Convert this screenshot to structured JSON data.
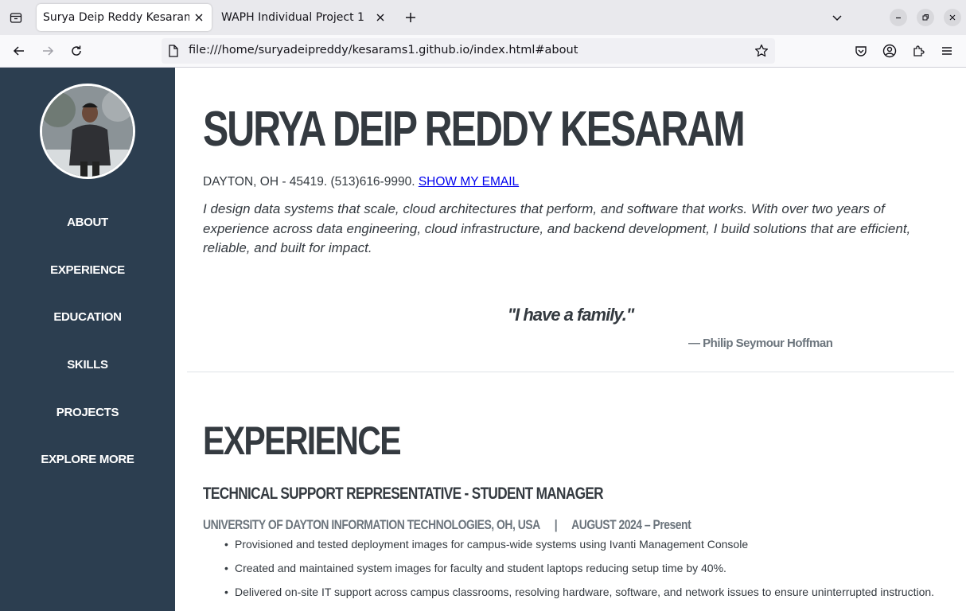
{
  "browser": {
    "tabs": [
      {
        "title": "Surya Deip Reddy Kesaram - I",
        "active": true
      },
      {
        "title": "WAPH Individual Project 1",
        "active": false
      }
    ],
    "url": "file:///home/suryadeipreddy/kesarams1.github.io/index.html#about"
  },
  "sidebar": {
    "items": [
      {
        "label": "ABOUT"
      },
      {
        "label": "EXPERIENCE"
      },
      {
        "label": "EDUCATION"
      },
      {
        "label": "SKILLS"
      },
      {
        "label": "PROJECTS"
      },
      {
        "label": "EXPLORE MORE"
      }
    ]
  },
  "about": {
    "name": "SURYA DEIP REDDY KESARAM",
    "contact": "DAYTON, OH - 45419. (513)616-9990.",
    "email_link": "SHOW MY EMAIL",
    "intro": "I design data systems that scale, cloud architectures that perform, and software that works. With over two years of experience across data engineering, cloud infrastructure, and backend development, I build solutions that are efficient, reliable, and built for impact.",
    "quote": "\"I have a family.\"",
    "quote_author": "— Philip Seymour Hoffman"
  },
  "experience": {
    "heading": "EXPERIENCE",
    "job_title": "TECHNICAL SUPPORT REPRESENTATIVE - STUDENT MANAGER",
    "company": "UNIVERSITY OF DAYTON INFORMATION TECHNOLOGIES, OH, USA",
    "separator": "|",
    "dates": "AUGUST 2024 – Present",
    "bullets": [
      "Provisioned and tested deployment images for campus-wide systems using Ivanti Management Console",
      "Created and maintained system images for faculty and student laptops reducing setup time by 40%.",
      "Delivered on-site IT support across campus classrooms, resolving hardware, software, and network issues to ensure uninterrupted instruction."
    ]
  },
  "colors": {
    "sidebar_bg": "#2c3e50",
    "text_dark": "#343a40",
    "text_muted": "#6c757d",
    "link": "#0000ee"
  }
}
